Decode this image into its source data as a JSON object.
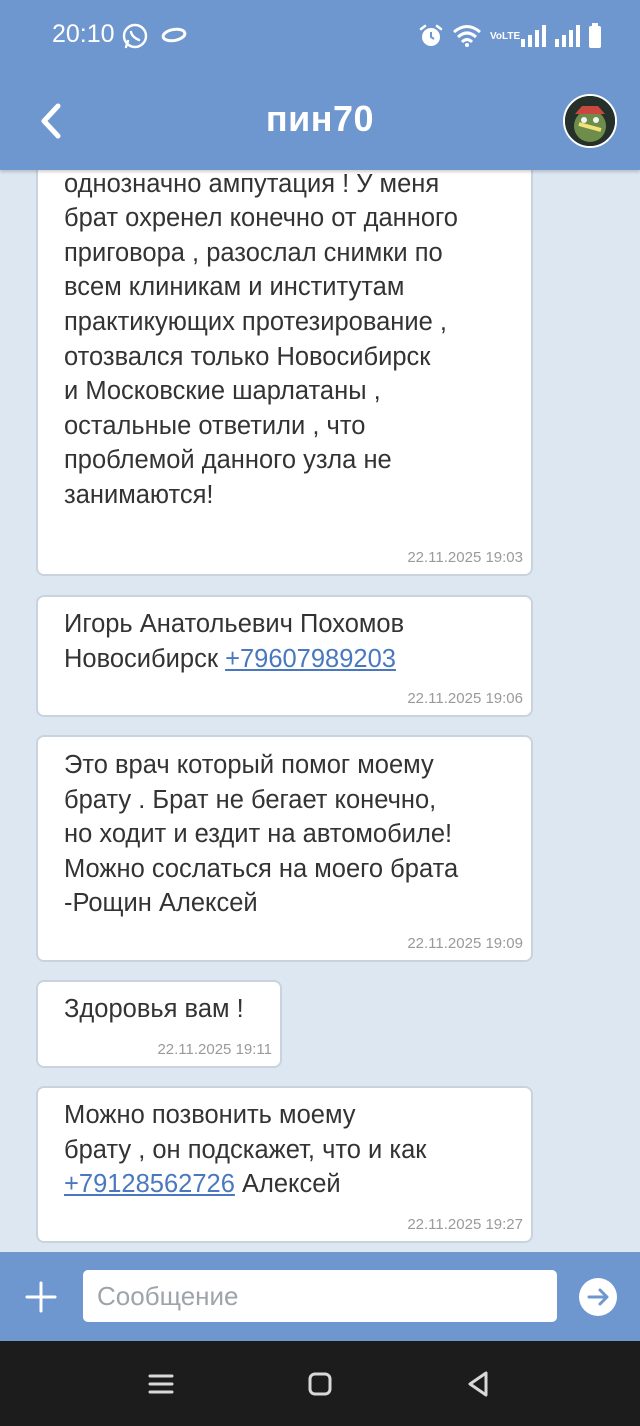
{
  "status_bar": {
    "time": "20:10",
    "network": "VoLTE"
  },
  "header": {
    "title": "пин70"
  },
  "messages": [
    {
      "text": "местные ижевские врачи сказали\nоднозначно ампутация ! У меня\nбрат охренел конечно от данного\nприговора , разослал снимки по\nвсем клиникам и институтам\nпрактикующих протезирование ,\nотозвался только Новосибирск\nи Московские шарлатаны ,\nостальные ответили , что\nпроблемой данного узла не\nзанимаются!",
      "timestamp": "22.11.2025 19:03"
    },
    {
      "text_prefix": "Игорь Анатольевич Похомов\nНовосибирск ",
      "link": "+79607989203",
      "timestamp": "22.11.2025 19:06"
    },
    {
      "text": "Это врач который помог моему\nбрату . Брат не бегает конечно,\nно ходит и ездит на автомобиле!\nМожно сослаться на моего брата\n-Рощин Алексей",
      "timestamp": "22.11.2025 19:09"
    },
    {
      "text": "Здоровья вам !",
      "timestamp": "22.11.2025 19:11"
    },
    {
      "text_prefix": "Можно позвонить моему\nбрату , он подскажет, что и как\n",
      "link": "+79128562726",
      "text_suffix": " Алексей",
      "timestamp": "22.11.2025 19:27"
    }
  ],
  "composer": {
    "placeholder": "Сообщение",
    "value": ""
  },
  "colors": {
    "header": "#6f97cf",
    "background": "#dde7f2",
    "link": "#4a78c0",
    "navbar": "#1c1c1c"
  },
  "icons": [
    "whatsapp-icon",
    "ring-icon",
    "alarm-icon",
    "wifi-icon",
    "signal-icon",
    "battery-icon",
    "back-arrow-icon",
    "plus-icon",
    "send-arrow-icon",
    "menu-icon",
    "home-icon",
    "back-triangle-icon"
  ]
}
